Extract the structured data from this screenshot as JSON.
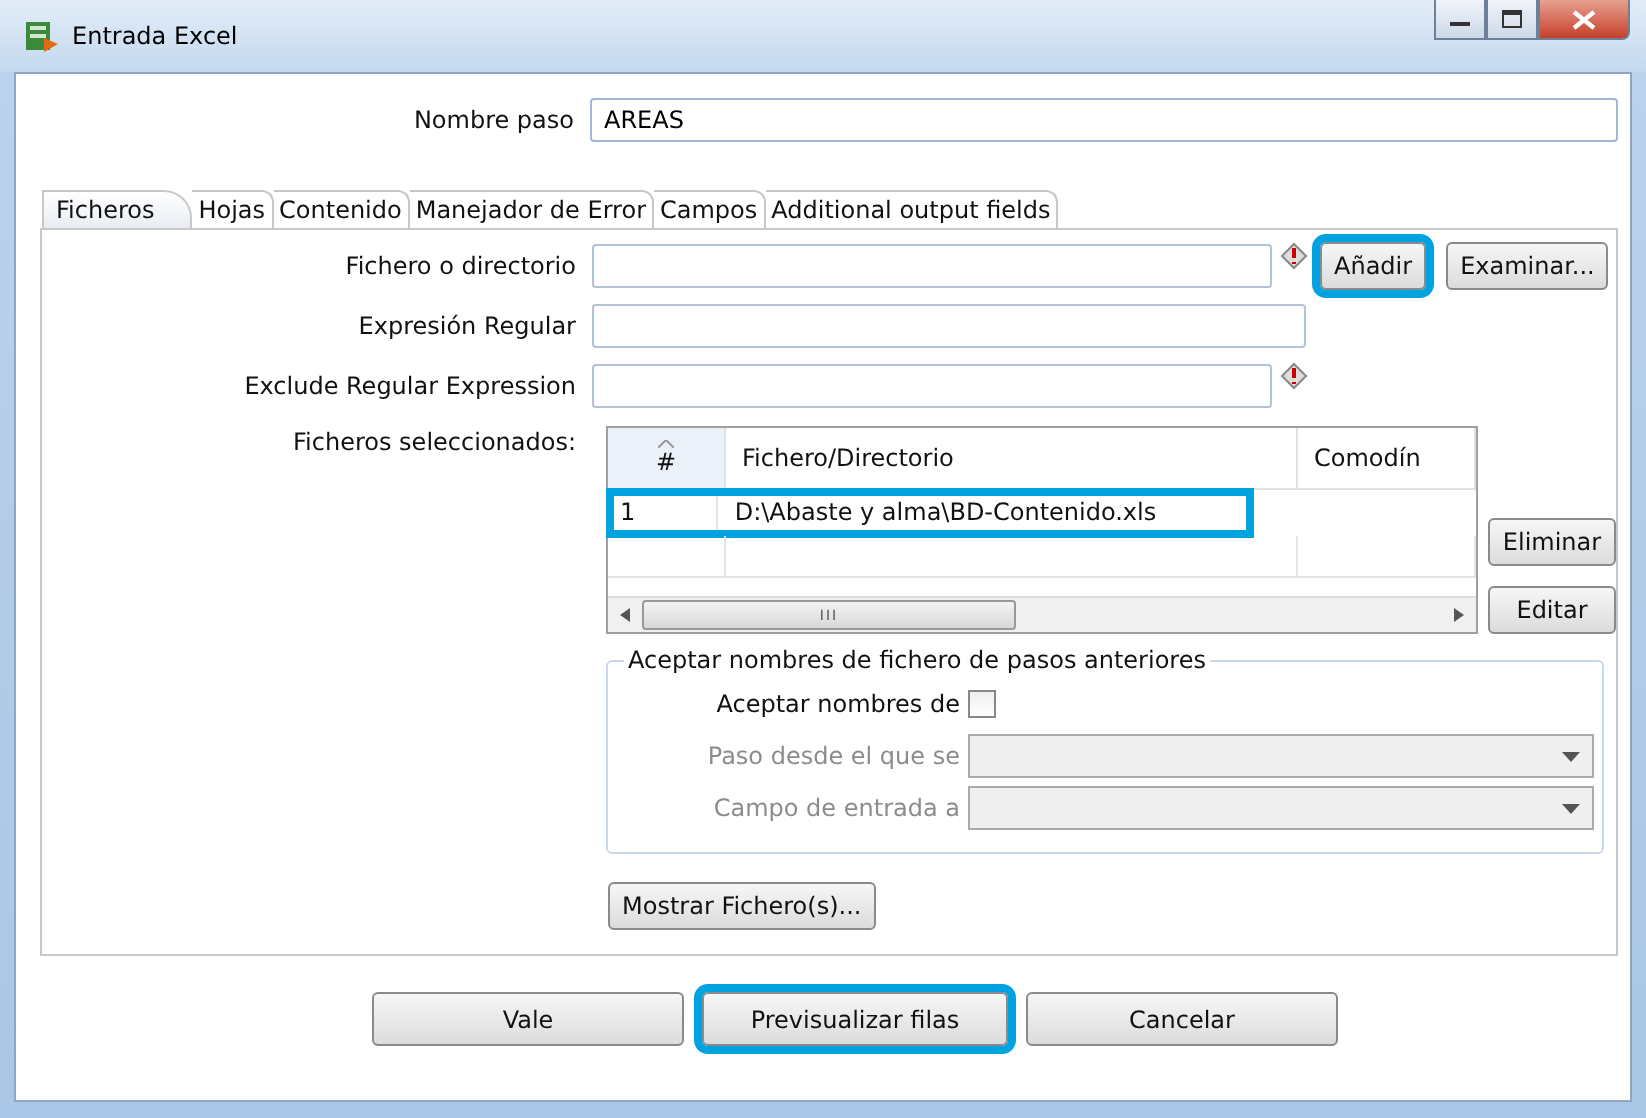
{
  "window": {
    "title": "Entrada Excel"
  },
  "step_name": {
    "label": "Nombre paso",
    "value": "AREAS"
  },
  "tabs": [
    {
      "label": "Ficheros",
      "selected": true
    },
    {
      "label": "Hojas",
      "selected": false
    },
    {
      "label": "Contenido",
      "selected": false
    },
    {
      "label": "Manejador de Error",
      "selected": false
    },
    {
      "label": "Campos",
      "selected": false
    },
    {
      "label": "Additional output fields",
      "selected": false
    }
  ],
  "file_field": {
    "label": "Fichero o directorio",
    "add_button": {
      "label": "Añadir",
      "highlighted": true
    },
    "browse_button": {
      "label": "Examinar...",
      "highlighted": false
    }
  },
  "regex_field": {
    "label": "Expresión Regular"
  },
  "exclude_field": {
    "label": "Exclude Regular Expression"
  },
  "selected_files": {
    "label": "Ficheros seleccionados:",
    "columns": [
      "#",
      "Fichero/Directorio",
      "Comodín"
    ],
    "rows": [
      {
        "cells": [
          "1",
          "D:\\Abaste y alma\\BD-Contenido.xls",
          ""
        ],
        "highlighted": true
      }
    ],
    "scroll_mark": "III",
    "buttons": [
      {
        "label": "Eliminar"
      },
      {
        "label": "Editar"
      }
    ]
  },
  "accept_group": {
    "title": "Aceptar nombres de fichero de pasos anteriores",
    "accept_checkbox": {
      "label": "Aceptar nombres de",
      "checked": false
    },
    "fields": [
      {
        "label": "Paso desde el que se",
        "disabled": true
      },
      {
        "label": "Campo de entrada a",
        "disabled": true
      }
    ]
  },
  "show_files_button": {
    "label": "Mostrar Fichero(s)..."
  },
  "footer_buttons": [
    {
      "label": "Vale",
      "highlighted": false
    },
    {
      "label": "Previsualizar filas",
      "highlighted": true
    },
    {
      "label": "Cancelar",
      "highlighted": false
    }
  ]
}
